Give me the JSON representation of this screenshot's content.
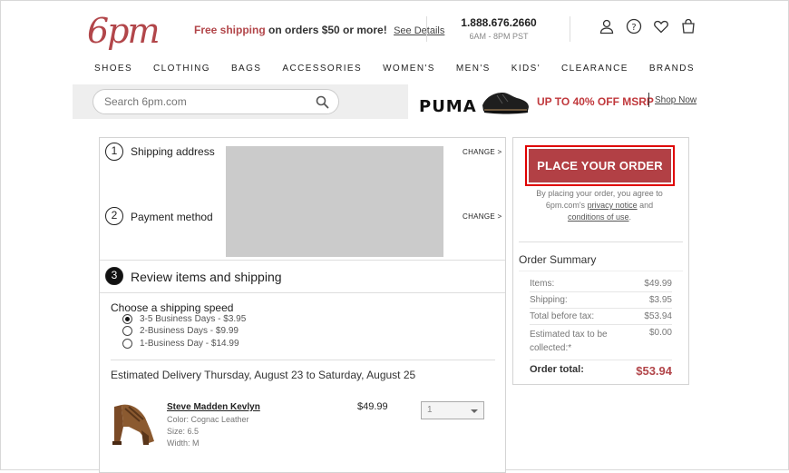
{
  "header": {
    "logo": "6pm",
    "promo_red": "Free shipping",
    "promo_rest": " on orders $50 or more!",
    "promo_link": "See Details",
    "phone": "1.888.676.2660",
    "hours": "6AM - 8PM PST",
    "icons": [
      "user-icon",
      "help-icon",
      "heart-icon",
      "cart-icon"
    ]
  },
  "nav": [
    "SHOES",
    "CLOTHING",
    "BAGS",
    "ACCESSORIES",
    "WOMEN'S",
    "MEN'S",
    "KIDS'",
    "CLEARANCE",
    "BRANDS"
  ],
  "search": {
    "placeholder": "Search 6pm.com"
  },
  "ad": {
    "brand": "PUMA",
    "text": "UP TO 40% OFF MSRP",
    "link": "Shop Now"
  },
  "checkout": {
    "step1": {
      "num": "1",
      "label": "Shipping address",
      "change": "CHANGE >"
    },
    "step2": {
      "num": "2",
      "label": "Payment method",
      "change": "CHANGE >"
    },
    "step3": {
      "num": "3",
      "label": "Review items and shipping"
    },
    "speed_title": "Choose a shipping speed",
    "speeds": [
      {
        "label": "3-5 Business Days - $3.95",
        "selected": true
      },
      {
        "label": "2-Business Days - $9.99",
        "selected": false
      },
      {
        "label": "1-Business Day - $14.99",
        "selected": false
      }
    ],
    "delivery": "Estimated Delivery Thursday, August 23 to Saturday, August 25",
    "product": {
      "name": "Steve Madden Kevlyn",
      "color": "Color: Cognac Leather",
      "size": "Size: 6.5",
      "width": "Width: M",
      "price": "$49.99",
      "qty": "1"
    }
  },
  "summary": {
    "button": "PLACE YOUR ORDER",
    "agree_pre": "By placing your order, you agree to 6pm.com's",
    "privacy": "privacy notice",
    "and": "and",
    "conditions": "conditions of use",
    "period": ".",
    "title": "Order Summary",
    "rows": [
      {
        "label": "Items:",
        "value": "$49.99"
      },
      {
        "label": "Shipping:",
        "value": "$3.95"
      },
      {
        "label": "Total before tax:",
        "value": "$53.94"
      },
      {
        "label": "Estimated tax to be collected:*",
        "value": "$0.00"
      }
    ],
    "total_label": "Order total:",
    "total_value": "$53.94"
  },
  "colors": {
    "brand": "#b2464a",
    "button": "#b24045",
    "highlight": "#e00000"
  }
}
